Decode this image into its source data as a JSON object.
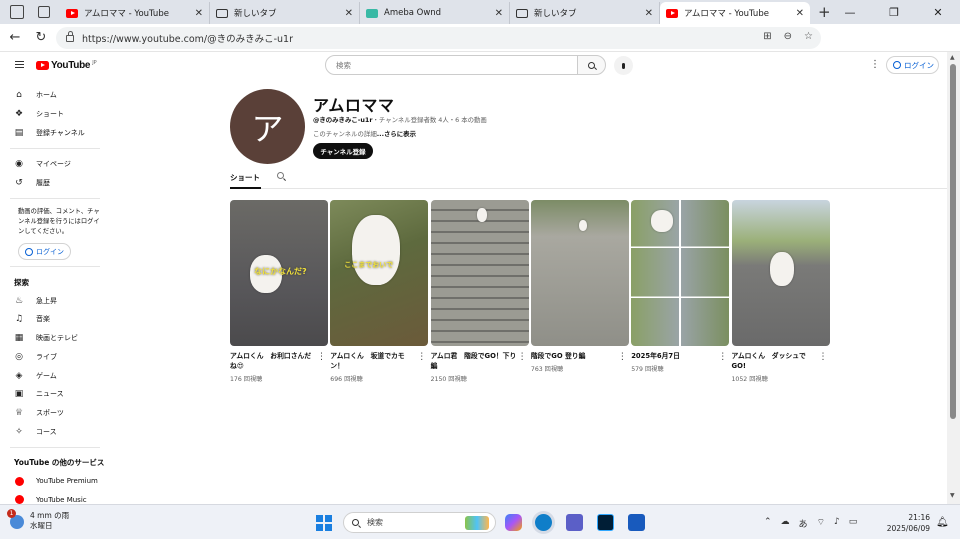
{
  "browser": {
    "tabs": [
      {
        "title": "アムロママ - YouTube",
        "type": "yt",
        "active": false
      },
      {
        "title": "新しいタブ",
        "type": "nt",
        "active": false
      },
      {
        "title": "Ameba Ownd",
        "type": "am",
        "active": false
      },
      {
        "title": "新しいタブ",
        "type": "nt",
        "active": false
      },
      {
        "title": "アムロママ - YouTube",
        "type": "yt",
        "active": true
      }
    ],
    "url": "https://www.youtube.com/@きのみきみこ-u1r"
  },
  "youtube": {
    "logo_text": "YouTube",
    "logo_region": "JP",
    "search_placeholder": "検索",
    "login_label": "ログイン",
    "sidebar": {
      "main": [
        {
          "label": "ホーム",
          "icon": "home-icon"
        },
        {
          "label": "ショート",
          "icon": "shorts-icon"
        },
        {
          "label": "登録チャンネル",
          "icon": "subscriptions-icon"
        }
      ],
      "you": [
        {
          "label": "マイページ",
          "icon": "user-icon"
        },
        {
          "label": "履歴",
          "icon": "history-icon"
        }
      ],
      "login_message": "動画の評価、コメント、チャンネル登録を行うにはログインしてください。",
      "explore_heading": "探索",
      "explore": [
        {
          "label": "急上昇",
          "icon": "trending-icon"
        },
        {
          "label": "音楽",
          "icon": "music-icon"
        },
        {
          "label": "映画とテレビ",
          "icon": "film-icon"
        },
        {
          "label": "ライブ",
          "icon": "live-icon"
        },
        {
          "label": "ゲーム",
          "icon": "gaming-icon"
        },
        {
          "label": "ニュース",
          "icon": "news-icon"
        },
        {
          "label": "スポーツ",
          "icon": "trophy-icon"
        },
        {
          "label": "コース",
          "icon": "lightbulb-icon"
        }
      ],
      "more_heading": "YouTube の他のサービス",
      "more": [
        {
          "label": "YouTube Premium"
        },
        {
          "label": "YouTube Music"
        }
      ]
    },
    "channel": {
      "avatar_letter": "ア",
      "name": "アムロママ",
      "handle": "@きのみきみこ-u1r",
      "stats": "・チャンネル登録者数 4人・6 本の動画",
      "desc_prefix": "このチャンネルの詳細",
      "desc_more": "...さらに表示",
      "subscribe_label": "チャンネル登録",
      "tab_shorts": "ショート"
    },
    "shorts": [
      {
        "title": "アムロくん　お利口さんだね😍",
        "views": "176 回視聴",
        "caption": "なにかなんだ?"
      },
      {
        "title": "アムロくん　坂道でカモン！",
        "views": "696 回視聴",
        "caption": "ここまでおいで"
      },
      {
        "title": "アムロ君　階段でGO！下り編",
        "views": "2150 回視聴",
        "caption": ""
      },
      {
        "title": "階段でGO 登り編",
        "views": "763 回視聴",
        "caption": ""
      },
      {
        "title": "2025年6月7日",
        "views": "579 回視聴",
        "caption": ""
      },
      {
        "title": "アムロくん　ダッシュでGO!",
        "views": "1052 回視聴",
        "caption": ""
      }
    ]
  },
  "taskbar": {
    "weather_line1": "4 mm の雨",
    "weather_line2": "水曜日",
    "weather_badge": "1",
    "search_label": "検索",
    "ime_label": "あ",
    "time": "21:16",
    "date": "2025/06/09"
  }
}
